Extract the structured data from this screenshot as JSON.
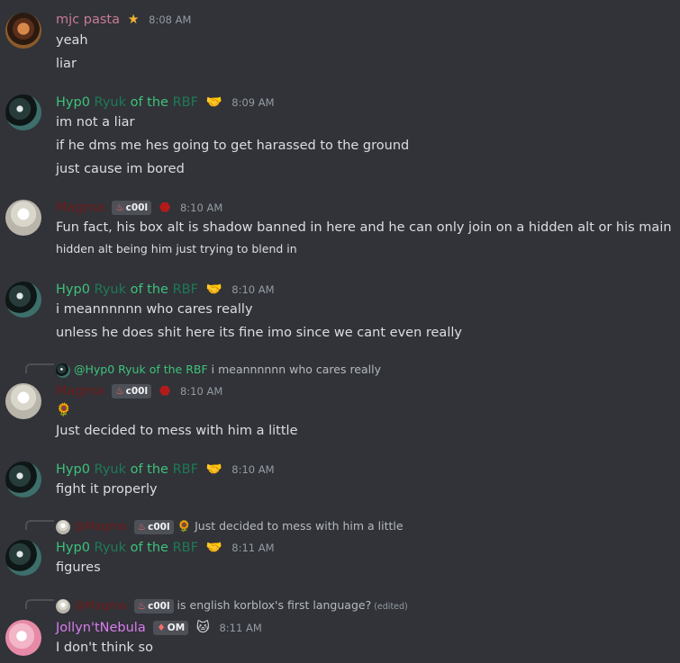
{
  "messages": [
    {
      "author": "mjc pasta",
      "badge_icon": "star-icon",
      "time": "8:08 AM",
      "lines": [
        "yeah",
        "liar"
      ]
    },
    {
      "author_parts": [
        "Hyp0",
        "Ryuk",
        "of the",
        "RBF"
      ],
      "badge_icon": "handshake-icon",
      "time": "8:09 AM",
      "lines": [
        "im not a liar",
        "if he dms me hes going to get harassed to the ground",
        "just cause im bored"
      ]
    },
    {
      "author": "Magma",
      "tag": "c00l",
      "time": "8:10 AM",
      "lines": [
        "Fun fact, his box alt is shadow banned in here and he can only join on a hidden alt or his main",
        "hidden alt being him just trying to blend in"
      ]
    },
    {
      "author_parts": [
        "Hyp0",
        "Ryuk",
        "of the",
        "RBF"
      ],
      "time": "8:10 AM",
      "lines": [
        "i meannnnnn who cares really",
        "unless he does shit here its fine imo since we cant even really"
      ]
    },
    {
      "reply": {
        "mention": "@Hyp0 Ryuk of the RBF",
        "text": "i meannnnnn who cares really"
      },
      "author": "Magma",
      "tag": "c00l",
      "time": "8:10 AM",
      "lines": [
        "Just decided to mess with him a little"
      ]
    },
    {
      "author_parts": [
        "Hyp0",
        "Ryuk",
        "of the",
        "RBF"
      ],
      "time": "8:10 AM",
      "lines": [
        "fight it properly"
      ]
    },
    {
      "reply": {
        "mention": "@Magma",
        "tag": "c00l",
        "text": "Just decided to mess with him a little"
      },
      "author_parts": [
        "Hyp0",
        "Ryuk",
        "of the",
        "RBF"
      ],
      "time": "8:11 AM",
      "lines": [
        "figures"
      ]
    },
    {
      "reply": {
        "mention": "@Magma",
        "tag": "c00l",
        "text": "is english korblox's first language?",
        "edited": "(edited)"
      },
      "author": "Jollyn'tNebula",
      "tag": "OM",
      "time": "8:11 AM",
      "lines": [
        "I don't think so"
      ]
    }
  ]
}
